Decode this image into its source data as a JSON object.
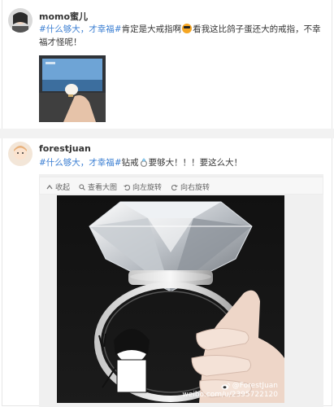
{
  "posts": [
    {
      "author": "momo蜜儿",
      "tag": "#什么够大，才幸福#",
      "text_a": "肯定是大戒指啊",
      "text_b": "看我这比鸽子蛋还大的戒指，不幸福才怪呢！"
    },
    {
      "author": "forestjuan",
      "tag": "#什么够大，才幸福#",
      "text_a": "钻戒",
      "text_b": "要够大！！！要这么大！",
      "toolbar": {
        "collect": "收起",
        "view_large": "查看大图",
        "rotate_left": "向左旋转",
        "rotate_right": "向右旋转"
      },
      "watermark": {
        "handle": "@ForestJuan",
        "url": "weibo.com/u/2395722120"
      }
    }
  ],
  "colors": {
    "tag": "#3a7ed2",
    "divider": "#f2f2f2"
  }
}
